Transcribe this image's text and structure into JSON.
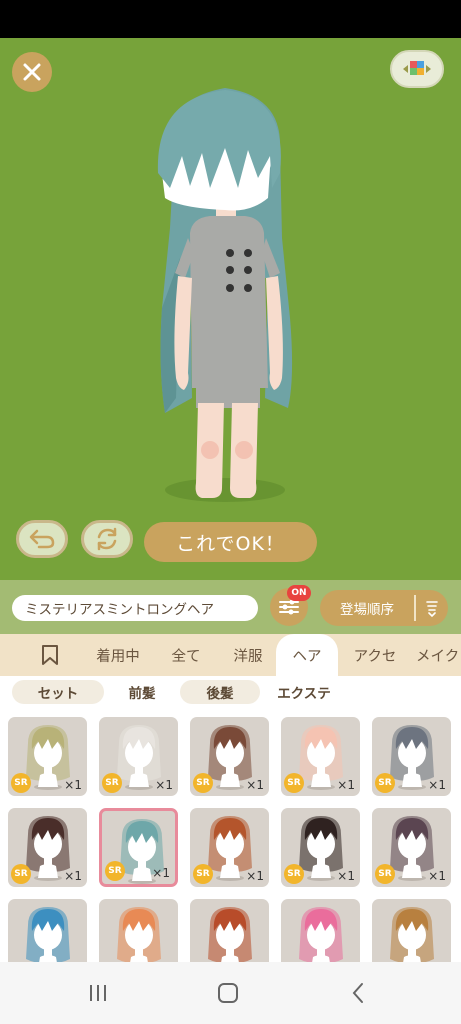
{
  "item_name": "ミステリアスミントロングヘア",
  "ok_label": "これでOK！",
  "filter_badge": "ON",
  "sort_label": "登場順序",
  "tabs": [
    {
      "label": ""
    },
    {
      "label": "着用中"
    },
    {
      "label": "全て"
    },
    {
      "label": "洋服"
    },
    {
      "label": "ヘア"
    },
    {
      "label": "アクセ"
    },
    {
      "label": "メイク"
    }
  ],
  "active_tab": "ヘア",
  "subtabs": [
    {
      "label": "セット"
    },
    {
      "label": "前髪"
    },
    {
      "label": "後髪"
    },
    {
      "label": "エクステ"
    }
  ],
  "active_subtab": "前髪",
  "items": [
    {
      "rarity": "SR",
      "count": "×1",
      "hair_color": "#b8b278"
    },
    {
      "rarity": "SR",
      "count": "×1",
      "hair_color": "#e8e4df"
    },
    {
      "rarity": "SR",
      "count": "×1",
      "hair_color": "#7a4a38"
    },
    {
      "rarity": "SR",
      "count": "×1",
      "hair_color": "#f5c3b2"
    },
    {
      "rarity": "SR",
      "count": "×1",
      "hair_color": "#6d7480"
    },
    {
      "rarity": "SR",
      "count": "×1",
      "hair_color": "#4a2e2a"
    },
    {
      "rarity": "SR",
      "count": "×1",
      "hair_color": "#6ea7a9"
    },
    {
      "rarity": "SR",
      "count": "×1",
      "hair_color": "#b4552c"
    },
    {
      "rarity": "SR",
      "count": "×1",
      "hair_color": "#2f2220"
    },
    {
      "rarity": "SR",
      "count": "×1",
      "hair_color": "#5b4551"
    },
    {
      "rarity": "",
      "count": "",
      "hair_color": "#3d8fc0"
    },
    {
      "rarity": "",
      "count": "",
      "hair_color": "#e88a55"
    },
    {
      "rarity": "",
      "count": "",
      "hair_color": "#b84c2a"
    },
    {
      "rarity": "",
      "count": "",
      "hair_color": "#ea6d9c"
    },
    {
      "rarity": "",
      "count": "",
      "hair_color": "#b8803f"
    }
  ],
  "selected_item": 6,
  "colors": {
    "stage_bg": "#77a33a",
    "accent_gold": "#c9a35e",
    "selected_border": "#e88b9b",
    "badge_red": "#e8433f"
  }
}
